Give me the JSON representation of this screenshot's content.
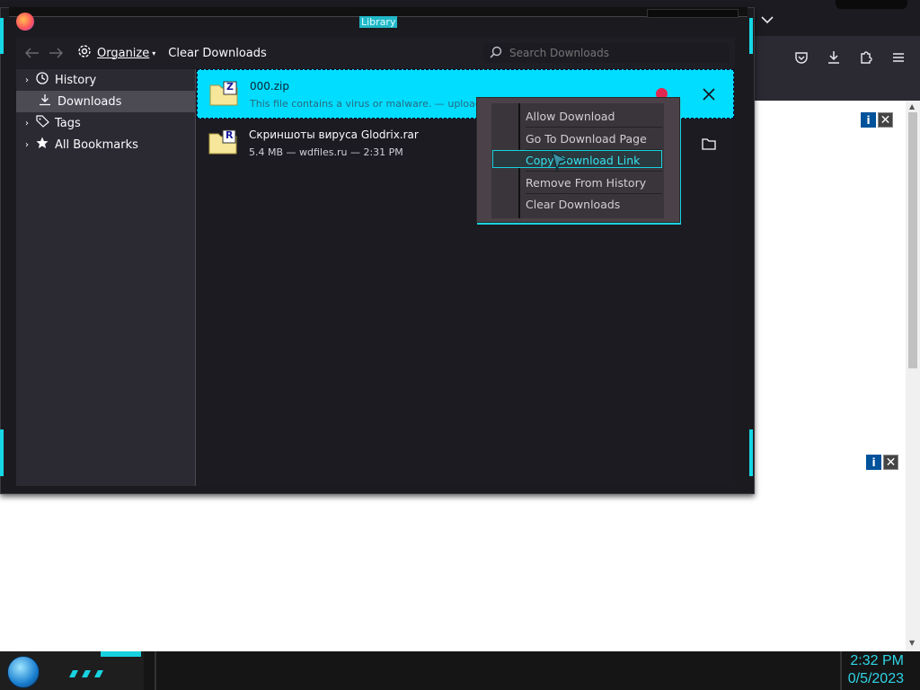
{
  "window": {
    "title": "Library"
  },
  "toolbar": {
    "organize_label": "Organize",
    "clear_downloads_label": "Clear Downloads",
    "search_placeholder": "Search Downloads"
  },
  "sidebar": {
    "items": [
      {
        "label": "History"
      },
      {
        "label": "Downloads"
      },
      {
        "label": "Tags"
      },
      {
        "label": "All Bookmarks"
      }
    ]
  },
  "downloads": [
    {
      "name": "000.zip",
      "meta": "This file contains a virus or malware. — upload.ee",
      "icon_letter": "Z"
    },
    {
      "name": "Скриншоты вируса Glodrix.rar",
      "meta": "5.4 MB — wdfiles.ru — 2:31 PM",
      "icon_letter": "R"
    }
  ],
  "context_menu": {
    "items": [
      {
        "label": "Allow Download"
      },
      {
        "label": "Go To Download Page"
      },
      {
        "label": "Copy Download Link"
      },
      {
        "label": "Remove From History"
      },
      {
        "label": "Clear Downloads"
      }
    ]
  },
  "ads": {
    "info_label": "i",
    "close_label": "✕"
  },
  "taskbar": {
    "time": "2:32 PM",
    "date": "0/5/2023"
  },
  "colors": {
    "accent": "#16d7e6",
    "selected_row": "#00ddff",
    "warning_badge": "#e22850"
  }
}
